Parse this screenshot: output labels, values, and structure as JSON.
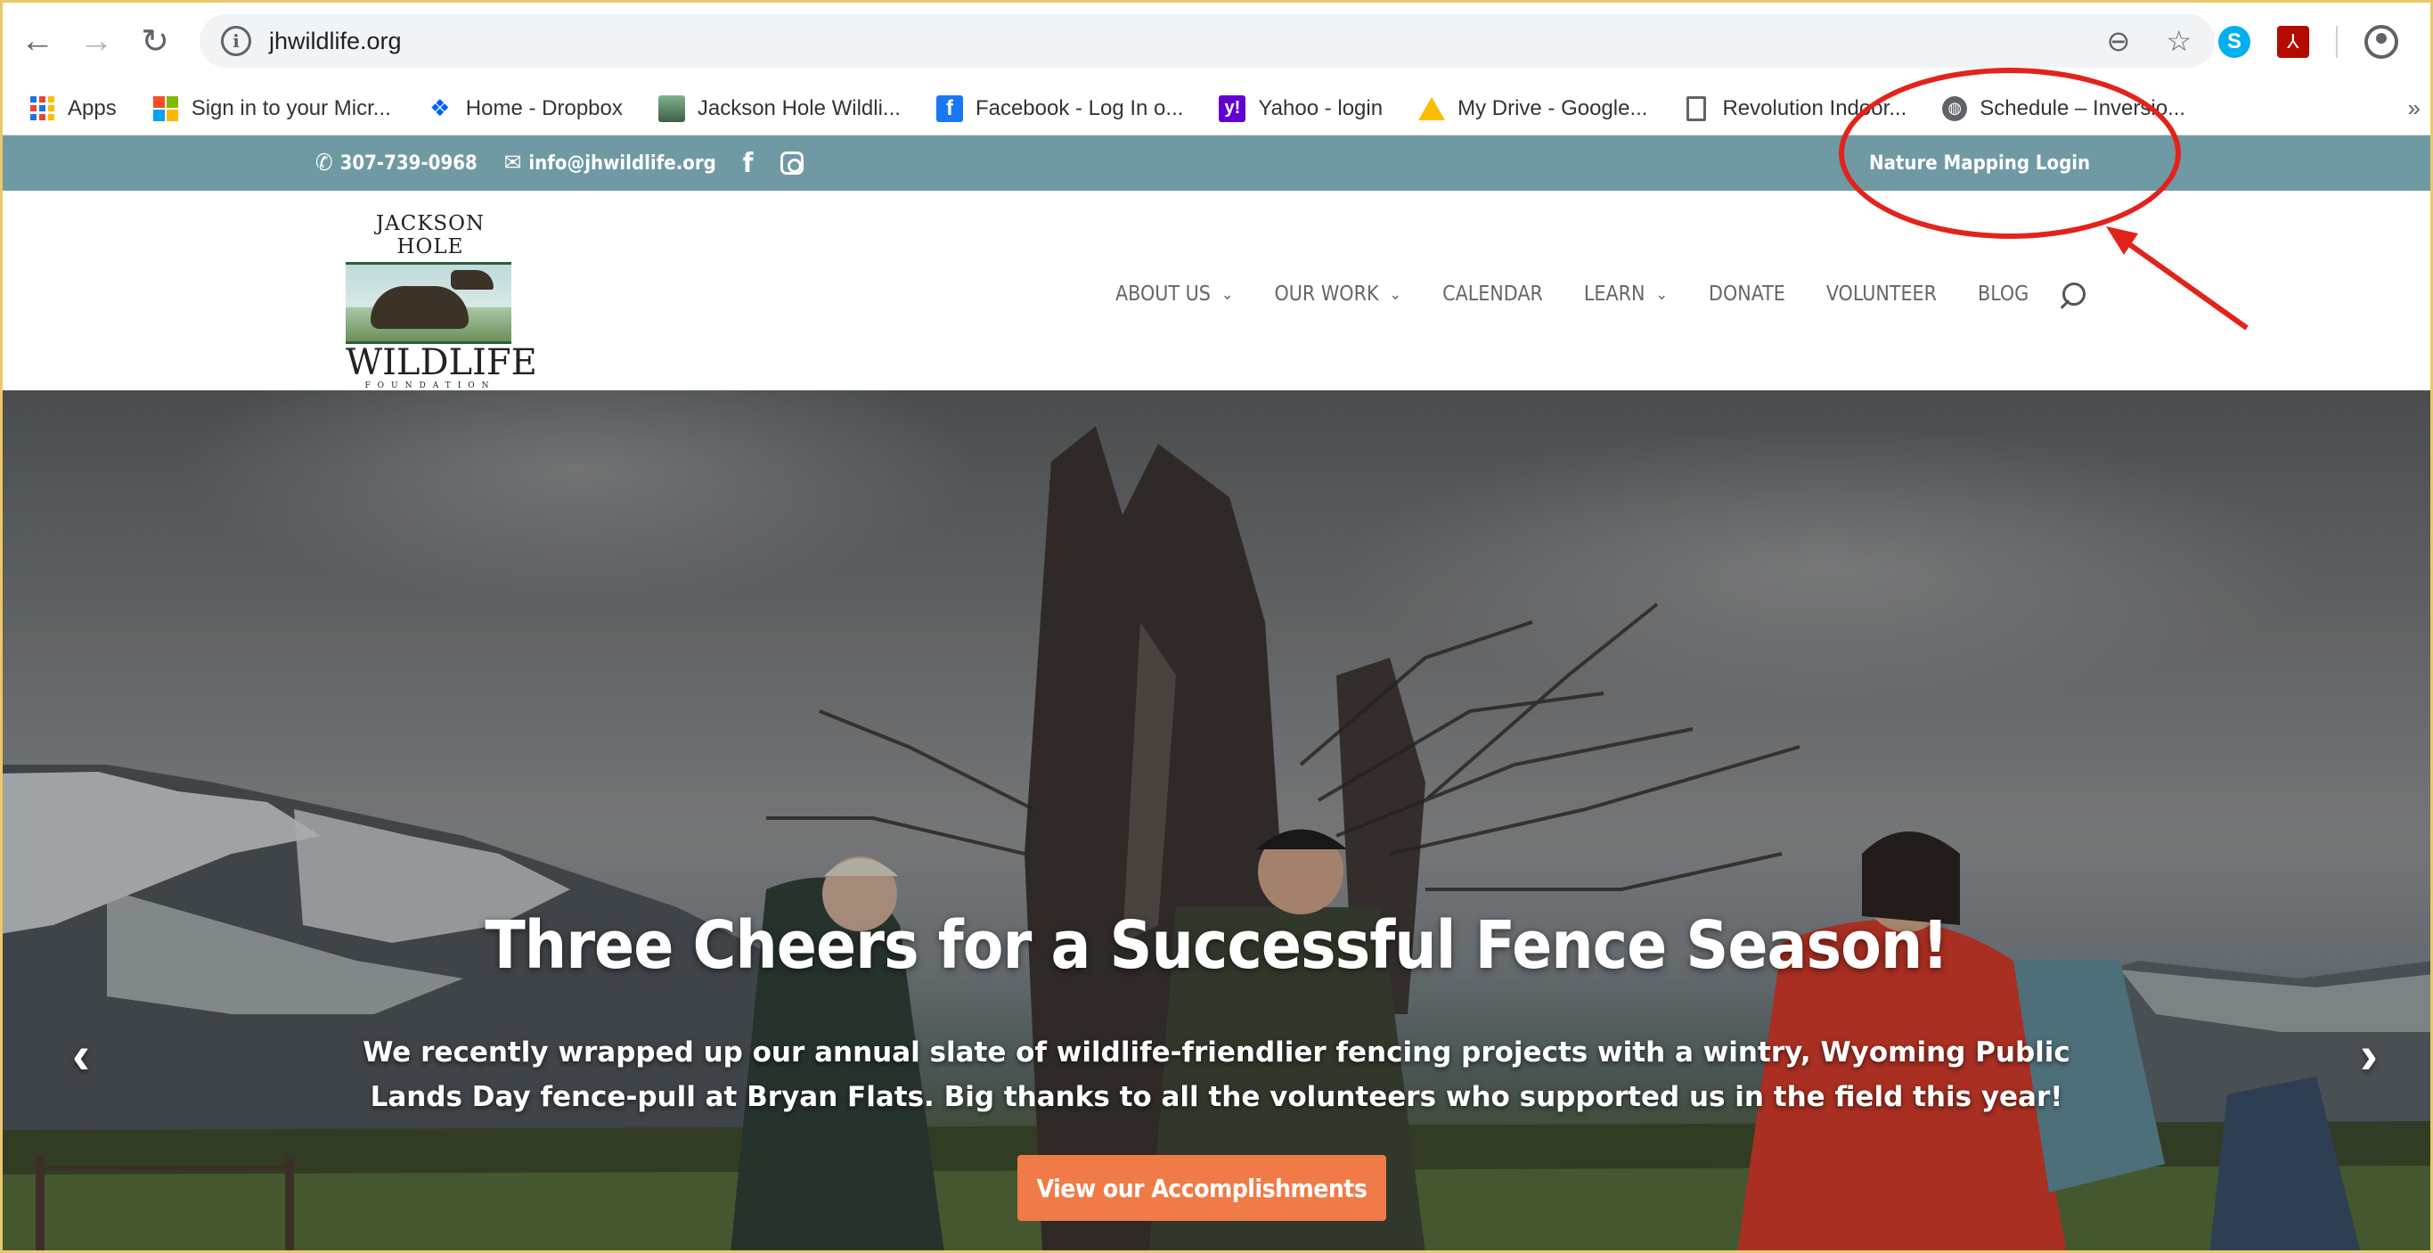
{
  "browser": {
    "url": "jhwildlife.org",
    "bookmarks": [
      {
        "label": "Apps",
        "icon": "apps-grid-icon"
      },
      {
        "label": "Sign in to your Micr...",
        "icon": "microsoft-icon"
      },
      {
        "label": "Home - Dropbox",
        "icon": "dropbox-icon"
      },
      {
        "label": "Jackson Hole Wildli...",
        "icon": "jhwf-favicon-icon"
      },
      {
        "label": "Facebook - Log In o...",
        "icon": "facebook-icon"
      },
      {
        "label": "Yahoo - login",
        "icon": "yahoo-icon"
      },
      {
        "label": "My Drive - Google...",
        "icon": "google-drive-icon"
      },
      {
        "label": "Revolution Indoor...",
        "icon": "document-icon"
      },
      {
        "label": "Schedule – Inversio...",
        "icon": "globe-icon"
      }
    ],
    "bookmarks_overflow": "»",
    "extensions": {
      "skype": "S",
      "pdf": "⅄"
    }
  },
  "topbar": {
    "phone": "307-739-0968",
    "email": "info@jhwildlife.org",
    "facebook": "f",
    "login_link": "Nature Mapping Login"
  },
  "logo": {
    "line1": "JACKSON HOLE",
    "line2": "WILDLIFE",
    "line3": "FOUNDATION"
  },
  "nav": {
    "items": [
      {
        "label": "ABOUT US",
        "caret": "⌄"
      },
      {
        "label": "OUR WORK",
        "caret": "⌄"
      },
      {
        "label": "CALENDAR"
      },
      {
        "label": "LEARN",
        "caret": "⌄"
      },
      {
        "label": "DONATE"
      },
      {
        "label": "VOLUNTEER"
      },
      {
        "label": "BLOG"
      }
    ]
  },
  "hero": {
    "title": "Three Cheers for a Successful Fence Season!",
    "line1": "We recently wrapped up our annual slate of wildlife-friendlier fencing projects with a wintry, Wyoming Public",
    "line2": "Lands Day fence-pull at Bryan Flats. Big thanks to all the volunteers who supported us in the field this year!",
    "cta": "View our Accomplishments",
    "prev": "‹",
    "next": "›"
  },
  "colors": {
    "topbar": "#6f9aa3",
    "cta": "#f07b48",
    "annotation": "#e3231b"
  }
}
